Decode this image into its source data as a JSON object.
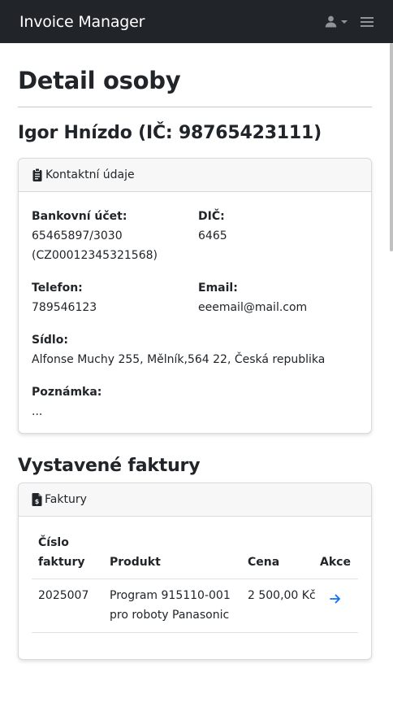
{
  "nav": {
    "brand": "Invoice Manager",
    "user_icon": "user-icon",
    "menu_icon": "hamburger-icon"
  },
  "page": {
    "title": "Detail osoby",
    "person_heading": "Igor Hnízdo (IČ: 98765423111)"
  },
  "contact": {
    "header_icon": "clipboard-icon",
    "header": "Kontaktní údaje",
    "bank_label": "Bankovní účet:",
    "bank_value": "65465897/3030 (CZ00012345321568)",
    "dic_label": "DIČ:",
    "dic_value": "6465",
    "phone_label": "Telefon:",
    "phone_value": "789546123",
    "email_label": "Email:",
    "email_value": "eeemail@mail.com",
    "address_label": "Sídlo:",
    "address_value": "Alfonse Muchy 255, Mělník,564 22, Česká republika",
    "note_label": "Poznámka:",
    "note_value": "..."
  },
  "invoices": {
    "section_title": "Vystavené faktury",
    "header_icon": "invoice-icon",
    "header": "Faktury",
    "columns": {
      "number": "Číslo faktury",
      "product": "Produkt",
      "price": "Cena",
      "action": "Akce"
    },
    "rows": [
      {
        "number": "2025007",
        "product": "Program 915110-001 pro roboty Panasonic",
        "price": "2 500,00 Kč",
        "action_icon": "arrow-right-icon"
      }
    ]
  },
  "colors": {
    "navbar": "#212529",
    "link": "#0d6efd",
    "card_header": "#f7f7f7"
  }
}
